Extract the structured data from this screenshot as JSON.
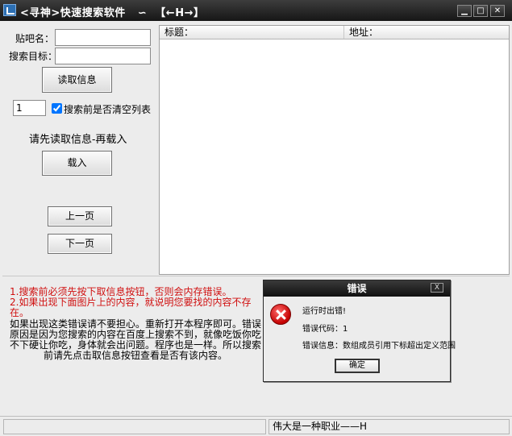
{
  "window": {
    "title": "<寻神>快速搜索软件   ∽  【←H→】",
    "minimize_icon": "minimize-icon",
    "maximize_icon": "maximize-icon",
    "close_icon": "close-icon"
  },
  "form": {
    "tieba_label": "贴吧名：",
    "tieba_value": "",
    "target_label": "搜索目标：",
    "target_value": "",
    "read_button": "读取信息",
    "page_count": "1",
    "clear_checkbox_label": "搜索前是否清空列表",
    "clear_checked": true,
    "hint": "请先读取信息-再载入",
    "load_button": "载入",
    "prev_button": "上一页",
    "next_button": "下一页"
  },
  "list": {
    "columns": [
      "标题：",
      "地址："
    ],
    "rows": []
  },
  "notes": {
    "red_lines": [
      "1.搜索前必须先按下取信息按钮，否则会内存错误。",
      "2.如果出现下面图片上的内容，就说明您要找的内容不存",
      "在。"
    ],
    "black_lines": [
      "如果出现这类错误请不要担心。重新打开本程序即可。错误",
      "原因是因为您搜索的内容在百度上搜索不到，就像吃饭你吃",
      "不下硬让你吃，身体就会出问题。程序也是一样。所以搜索",
      "前请先点击取信息按钮查看是否有该内容。"
    ]
  },
  "dialog": {
    "title": "错误",
    "close_label": "X",
    "line1": "运行时出错!",
    "line2": "错误代码：1",
    "line3": "错误信息：数组成员引用下标超出定义范围",
    "ok_button": "确定"
  },
  "status": {
    "left": "",
    "right": "伟大是一种职业——H"
  }
}
